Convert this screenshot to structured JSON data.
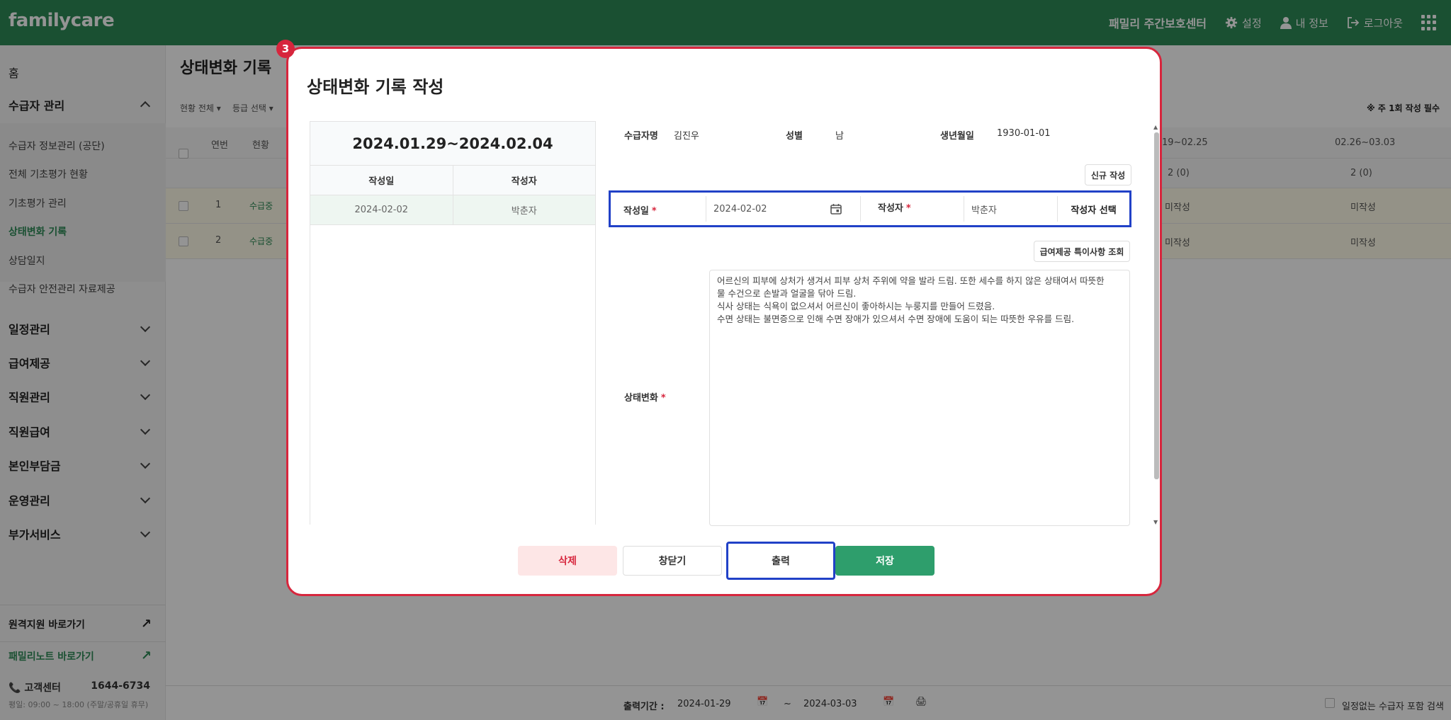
{
  "topbar": {
    "logo": "familycare",
    "org": "패밀리 주간보호센터",
    "settings": "설정",
    "my_info": "내 정보",
    "logout": "로그아웃"
  },
  "sidebar": {
    "home": "홈",
    "recipient_mgmt": "수급자 관리",
    "sub_items": [
      "수급자 정보관리 (공단)",
      "전체 기초평가 현황",
      "기초평가 관리",
      "상태변화 기록",
      "상담일지",
      "수급자 안전관리 자료제공"
    ],
    "groups": [
      "일정관리",
      "급여제공",
      "직원관리",
      "직원급여",
      "본인부담금",
      "운영관리",
      "부가서비스"
    ],
    "remote_link": "원격지원 바로가기",
    "familynote_link": "패밀리노트 바로가기",
    "cs_label": "고객센터",
    "cs_phone": "1644-6734",
    "cs_hours": "평일: 09:00 ~ 18:00 (주말/공휴일 휴무)"
  },
  "page": {
    "title": "상태변화 기록",
    "filter_status": "현황 전체",
    "filter_grade": "등급 선택",
    "notice": "※ 주 1회 작성 필수",
    "col_no": "연번",
    "col_status": "현황",
    "col_week1": "19~02.25",
    "col_week2": "02.26~03.03",
    "count1": "2 (0)",
    "count2": "2 (0)",
    "rows": [
      {
        "no": "1",
        "status": "수급중",
        "w1": "미작성",
        "w2": "미작성"
      },
      {
        "no": "2",
        "status": "수급중",
        "w1": "미작성",
        "w2": "미작성"
      }
    ],
    "footer_label": "출력기간 :",
    "footer_from": "2024-01-29",
    "footer_sep": "~",
    "footer_to": "2024-03-03",
    "footer_check": "일정없는 수급자 포함 검색"
  },
  "modal": {
    "badge": "3",
    "title": "상태변화 기록 작성",
    "period": "2024.01.29~2024.02.04",
    "list_head_date": "작성일",
    "list_head_writer": "작성자",
    "list_rows": [
      {
        "date": "2024-02-02",
        "writer": "박춘자"
      }
    ],
    "name_label": "수급자명",
    "name_value": "김진우",
    "gender_label": "성별",
    "gender_value": "남",
    "birth_label": "생년월일",
    "birth_value": "1930-01-01",
    "new_btn": "신규 작성",
    "date_label": "작성일",
    "date_value": "2024-02-02",
    "writer_label": "작성자",
    "writer_value": "박춘자",
    "writer_select": "작성자 선택",
    "benefit_btn": "급여제공 특이사항 조회",
    "status_label": "상태변화",
    "content_lines": [
      "어르신의 피부에 상처가 생겨서 피부 상처 주위에 약을 발라 드림.  또한 세수를 하지 않은 상태여서 따뜻한",
      "물 수건으로 손발과 얼굴을 닦아 드림.",
      "식사 상태는 식욕이 없으셔서 어르신이 좋아하시는 누룽지를 만들어 드렸음.",
      "수면 상태는 불면증으로 인해 수면 장애가 있으셔서 수면 장애에 도움이 되는 따뜻한 우유를 드림."
    ],
    "btn_delete": "삭제",
    "btn_close": "창닫기",
    "btn_print": "출력",
    "btn_save": "저장",
    "required_mark": "*"
  }
}
